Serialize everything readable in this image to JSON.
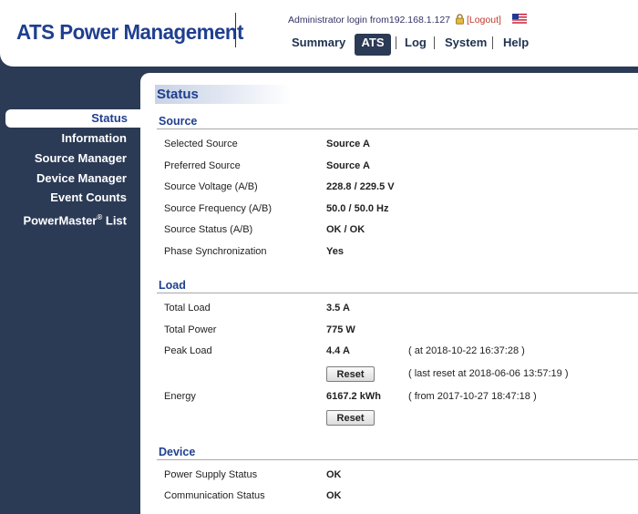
{
  "header": {
    "logo": "ATS Power Management",
    "login_prefix": "Administrator login from",
    "login_ip": "192.168.1.127",
    "logout_label": "[Logout]",
    "lock_icon": "lock-icon",
    "flag_icon": "us-flag-icon"
  },
  "topnav": {
    "items": [
      {
        "label": "Summary",
        "active": false
      },
      {
        "label": "ATS",
        "active": true
      },
      {
        "label": "Log",
        "active": false
      },
      {
        "label": "System",
        "active": false
      },
      {
        "label": "Help",
        "active": false
      }
    ]
  },
  "sidebar": {
    "items": [
      {
        "label": "Status",
        "active": true
      },
      {
        "label": "Information",
        "active": false
      },
      {
        "label": "Source Manager",
        "active": false
      },
      {
        "label": "Device Manager",
        "active": false
      },
      {
        "label": "Event Counts",
        "active": false
      },
      {
        "label": "PowerMaster",
        "sup": "®",
        "suffix": " List",
        "active": false
      }
    ]
  },
  "page_title": "Status",
  "source": {
    "title": "Source",
    "rows": [
      {
        "label": "Selected Source",
        "value": "Source A"
      },
      {
        "label": "Preferred Source",
        "value": "Source A"
      },
      {
        "label": "Source Voltage (A/B)",
        "value": "228.8 / 229.5 V"
      },
      {
        "label": "Source Frequency (A/B)",
        "value": "50.0 / 50.0 Hz"
      },
      {
        "label": "Source Status (A/B)",
        "value": "OK / OK"
      },
      {
        "label": "Phase Synchronization",
        "value": "Yes"
      }
    ]
  },
  "load": {
    "title": "Load",
    "total_load": {
      "label": "Total Load",
      "value": "3.5 A"
    },
    "total_power": {
      "label": "Total Power",
      "value": "775 W"
    },
    "peak_load": {
      "label": "Peak Load",
      "value": "4.4 A",
      "note": "( at 2018-10-22 16:37:28 )"
    },
    "peak_reset": {
      "button": "Reset",
      "note": "( last reset at 2018-06-06 13:57:19 )"
    },
    "energy": {
      "label": "Energy",
      "value": "6167.2 kWh",
      "note": "( from 2017-10-27 18:47:18 )"
    },
    "energy_reset": {
      "button": "Reset"
    }
  },
  "device": {
    "title": "Device",
    "rows": [
      {
        "label": "Power Supply Status",
        "value": "OK"
      },
      {
        "label": "Communication Status",
        "value": "OK"
      }
    ]
  },
  "colors": {
    "navy": "#2b3a55",
    "accent_blue": "#1f3f8f",
    "logout_red": "#c0392b"
  }
}
